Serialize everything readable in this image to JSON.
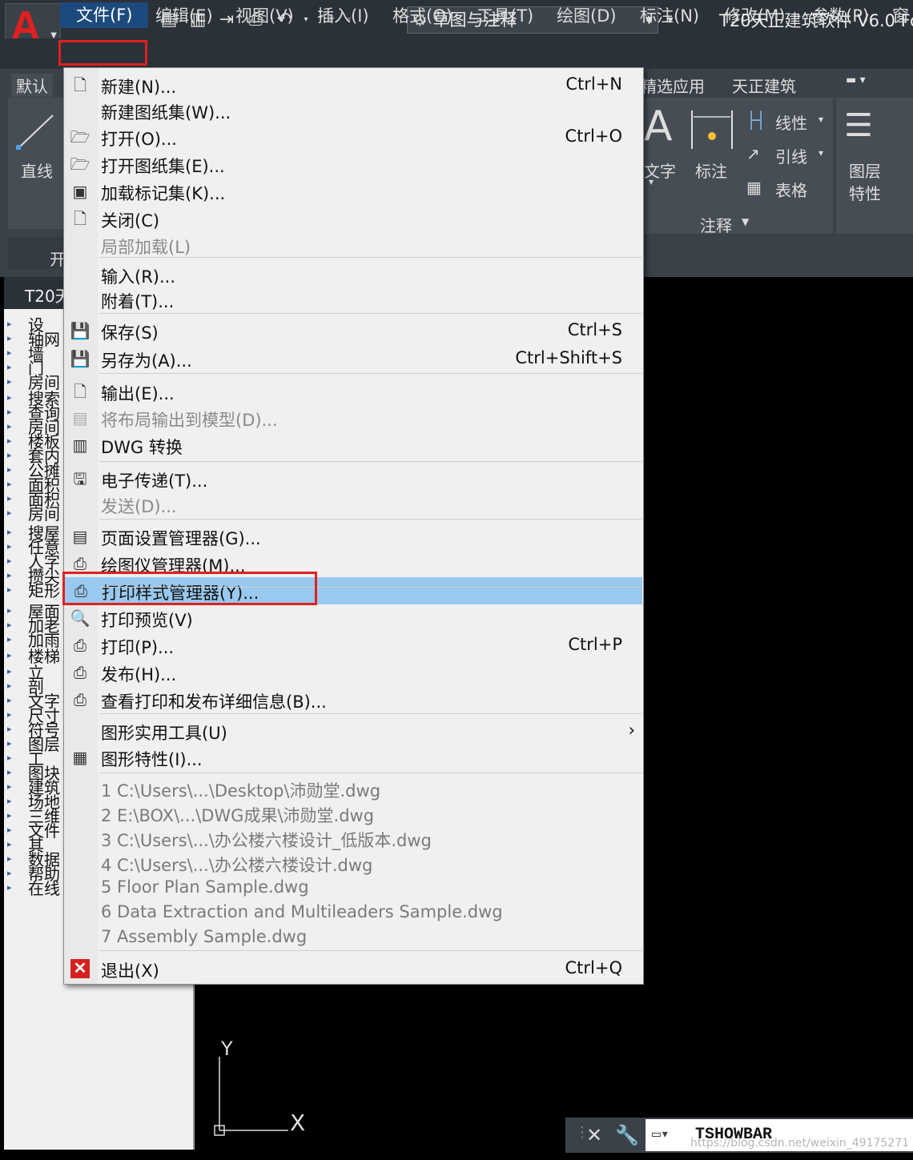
{
  "titlebar": {
    "workspace": "草图与注释",
    "title": "T20天正建筑软件 V6.0 Fo"
  },
  "menubar": {
    "items": [
      "文件(F)",
      "编辑(E)",
      "视图(V)",
      "插入(I)",
      "格式(O)",
      "工具(T)",
      "绘图(D)",
      "标注(N)",
      "修改(M)",
      "参数(P)",
      "窗"
    ]
  },
  "ribbon": {
    "tab_default": "默认",
    "tab_plugin": "精选应用",
    "tab_tangent": "天正建筑",
    "tab_open": "开",
    "line_label": "直线",
    "text_label": "文字",
    "dim_label": "标注",
    "linear_label": "线性",
    "leader_label": "引线",
    "table_label": "表格",
    "annotate_panel": "注释",
    "layer_label_1": "图层",
    "layer_label_2": "特性"
  },
  "left_panel": {
    "title": "T20天",
    "items": [
      "设",
      "轴网",
      "墙",
      "门",
      "房间",
      "搜索",
      "查询",
      "房间",
      "楼板",
      "套内",
      "公摊",
      "面积",
      "面积",
      "房间",
      "搜屋",
      "任意",
      "人字",
      "攒尖",
      "矩形",
      "屋面",
      "加老",
      "加雨",
      "楼梯",
      "立",
      "剖",
      "文字",
      "尺寸",
      "符号",
      "图层",
      "工",
      "图块",
      "建筑",
      "场地",
      "三维",
      "文件",
      "其",
      "数据",
      "帮助",
      "在线"
    ]
  },
  "file_menu": {
    "items": [
      {
        "label": "新建(N)...",
        "shortcut": "Ctrl+N",
        "icon": "new-file-icon"
      },
      {
        "label": "新建图纸集(W)...",
        "shortcut": "",
        "icon": ""
      },
      {
        "label": "打开(O)...",
        "shortcut": "Ctrl+O",
        "icon": "open-folder-icon"
      },
      {
        "label": "打开图纸集(E)...",
        "shortcut": "",
        "icon": "open-sheetset-icon"
      },
      {
        "label": "加载标记集(K)...",
        "shortcut": "",
        "icon": "markup-set-icon"
      },
      {
        "label": "关闭(C)",
        "shortcut": "",
        "icon": "close-file-icon"
      },
      {
        "label": "局部加载(L)",
        "shortcut": "",
        "icon": ""
      },
      {
        "label": "输入(R)...",
        "shortcut": "",
        "icon": ""
      },
      {
        "label": "附着(T)...",
        "shortcut": "",
        "icon": ""
      },
      {
        "label": "保存(S)",
        "shortcut": "Ctrl+S",
        "icon": "save-icon"
      },
      {
        "label": "另存为(A)...",
        "shortcut": "Ctrl+Shift+S",
        "icon": "save-as-icon"
      },
      {
        "label": "输出(E)...",
        "shortcut": "",
        "icon": "export-icon"
      },
      {
        "label": "将布局输出到模型(D)...",
        "shortcut": "",
        "icon": "layout-to-model-icon"
      },
      {
        "label": "DWG 转换",
        "shortcut": "",
        "icon": "dwg-convert-icon"
      },
      {
        "label": "电子传递(T)...",
        "shortcut": "",
        "icon": "etransmit-icon"
      },
      {
        "label": "发送(D)...",
        "shortcut": "",
        "icon": ""
      },
      {
        "label": "页面设置管理器(G)...",
        "shortcut": "",
        "icon": "page-setup-icon"
      },
      {
        "label": "绘图仪管理器(M)...",
        "shortcut": "",
        "icon": "plotter-manager-icon"
      },
      {
        "label": "打印样式管理器(Y)...",
        "shortcut": "",
        "icon": "plot-style-icon"
      },
      {
        "label": "打印预览(V)",
        "shortcut": "",
        "icon": "plot-preview-icon"
      },
      {
        "label": "打印(P)...",
        "shortcut": "Ctrl+P",
        "icon": "print-icon"
      },
      {
        "label": "发布(H)...",
        "shortcut": "",
        "icon": "publish-icon"
      },
      {
        "label": "查看打印和发布详细信息(B)...",
        "shortcut": "",
        "icon": "plot-details-icon"
      },
      {
        "label": "图形实用工具(U)",
        "shortcut": "",
        "icon": ""
      },
      {
        "label": "图形特性(I)...",
        "shortcut": "",
        "icon": "drawing-properties-icon"
      }
    ],
    "submenu_arrow": "›",
    "recent_files": [
      "1 C:\\Users\\...\\Desktop\\沛勋堂.dwg",
      "2 E:\\BOX\\...\\DWG成果\\沛勋堂.dwg",
      "3 C:\\Users\\...\\办公楼六楼设计_低版本.dwg",
      "4 C:\\Users\\...\\办公楼六楼设计.dwg",
      "5 Floor Plan Sample.dwg",
      "6 Data Extraction and Multileaders Sample.dwg",
      "7 Assembly Sample.dwg"
    ],
    "exit": {
      "label": "退出(X)",
      "shortcut": "Ctrl+Q",
      "icon": "exit-icon"
    },
    "highlighted_item": "打印样式管理器(Y)...",
    "highlight_color": "#99c9ef",
    "annotation_color": "#e02020"
  },
  "canvas": {
    "ucs_y": "Y",
    "ucs_x": "X"
  },
  "command_line": {
    "value": "TSHOWBAR",
    "watermark": "https://blog.csdn.net/weixin_49175271"
  }
}
